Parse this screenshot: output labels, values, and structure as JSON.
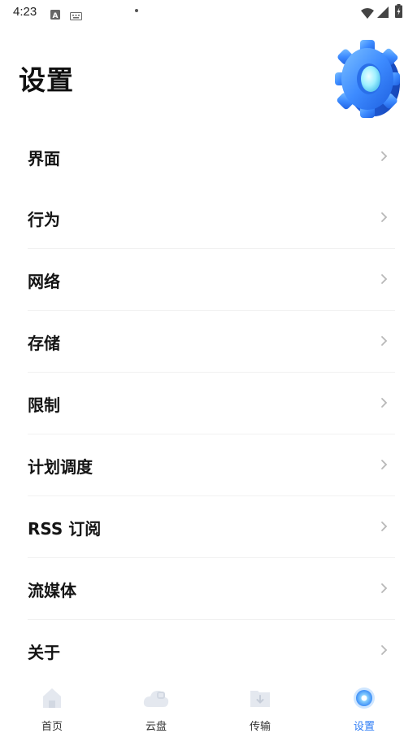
{
  "status_bar": {
    "time": "4:23"
  },
  "header": {
    "title": "设置"
  },
  "settings": {
    "items": [
      {
        "label": "界面"
      },
      {
        "label": "行为"
      },
      {
        "label": "网络"
      },
      {
        "label": "存储"
      },
      {
        "label": "限制"
      },
      {
        "label": "计划调度"
      },
      {
        "label": "RSS 订阅"
      },
      {
        "label": "流媒体"
      },
      {
        "label": "关于"
      }
    ]
  },
  "bottom_nav": {
    "items": [
      {
        "label": "首页",
        "icon": "home-icon"
      },
      {
        "label": "云盘",
        "icon": "cloud-icon"
      },
      {
        "label": "传输",
        "icon": "transfer-icon"
      },
      {
        "label": "设置",
        "icon": "settings-icon",
        "active": true
      }
    ]
  },
  "colors": {
    "accent": "#2f7df6",
    "text": "#141414",
    "divider": "#f1f1f1"
  }
}
